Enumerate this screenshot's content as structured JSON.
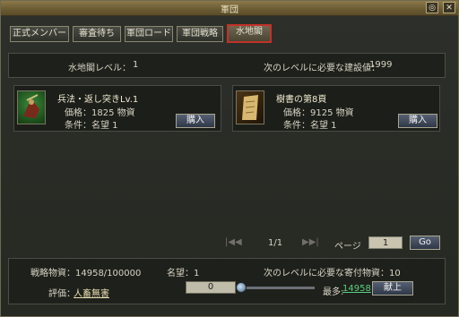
{
  "window": {
    "title": "軍団",
    "minimize": "◎",
    "close": "✕"
  },
  "tabs": [
    {
      "label": "正式メンバー"
    },
    {
      "label": "審査待ち"
    },
    {
      "label": "軍団ロード"
    },
    {
      "label": "軍団戦略"
    },
    {
      "label": "水地閣"
    }
  ],
  "active_tab": "水地閣",
  "info": {
    "level_label": "水地閣レベル：",
    "level_value": "1",
    "next_label": "次のレベルに必要な建設値：",
    "next_value": "1999"
  },
  "items": [
    {
      "name": "兵法・返し突きLv.1",
      "price_label": "価格：",
      "price": "1825 物資",
      "cond_label": "条件：",
      "cond": "名望 1",
      "buy": "購入",
      "icon": "warrior-rider-icon"
    },
    {
      "name": "樹書の第8頁",
      "price_label": "価格：",
      "price": "9125 物資",
      "cond_label": "条件：",
      "cond": "名望 1",
      "buy": "購入",
      "icon": "scroll-icon"
    }
  ],
  "pagination": {
    "page": "1/1",
    "page_label": "ページ",
    "page_input": "1",
    "go": "Go"
  },
  "footer": {
    "resources": "戦略物資：14958/100000",
    "fame": "名望：1",
    "next_donation": "次のレベルに必要な寄付物資：10",
    "rating_label": "評価：",
    "rating_value": "人畜無害",
    "slider_value": "0",
    "max_label": "最多:",
    "max_value": "14958",
    "submit": "献上"
  }
}
